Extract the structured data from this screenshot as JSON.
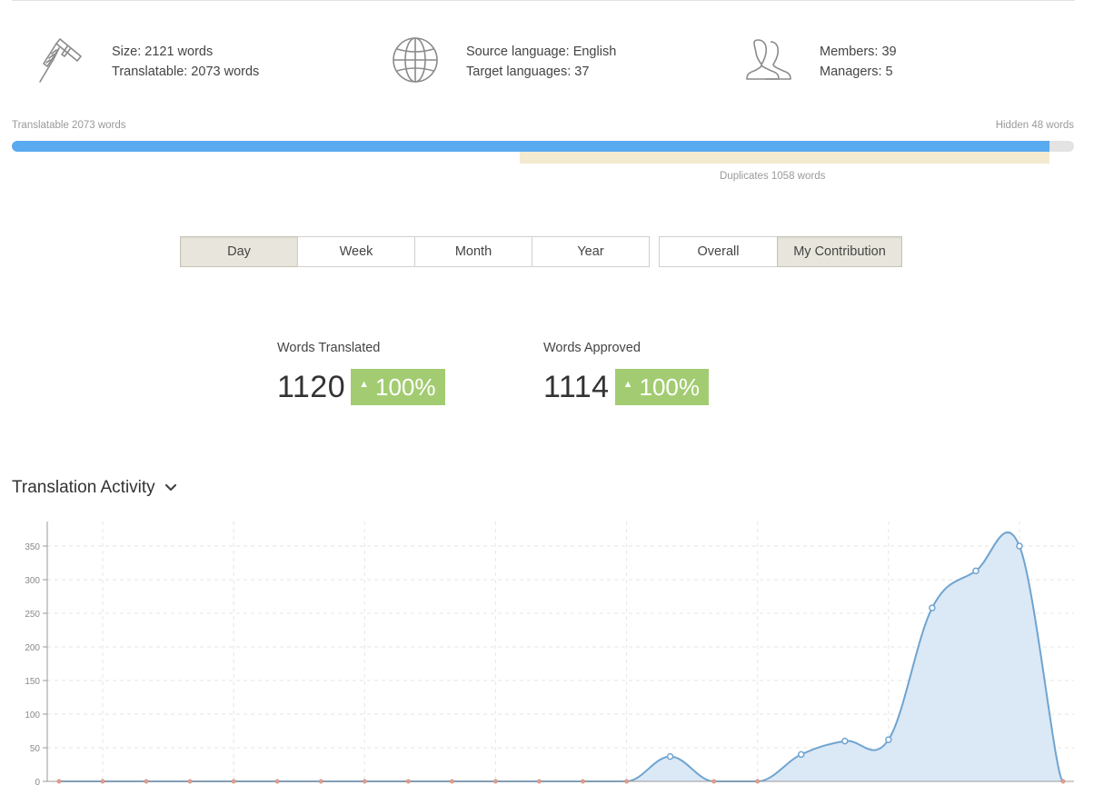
{
  "stats": {
    "size": {
      "size_line": "Size: 2121 words",
      "translatable_line": "Translatable: 2073 words",
      "icon": "calipers-icon"
    },
    "language": {
      "source_line": "Source language: English",
      "target_line": "Target languages: 37",
      "icon": "globe-icon"
    },
    "team": {
      "members_line": "Members: 39",
      "managers_line": "Managers: 5",
      "icon": "users-icon"
    }
  },
  "progress": {
    "translatable_label": "Translatable 2073 words",
    "hidden_label": "Hidden 48 words",
    "duplicates_label": "Duplicates 1058 words",
    "translatable_fraction": 0.977,
    "duplicates_fraction": 0.499,
    "fill_color": "#5aaaf0",
    "duplicates_color": "#f3ead0"
  },
  "period_tabs": {
    "items": [
      {
        "label": "Day",
        "active": true
      },
      {
        "label": "Week",
        "active": false
      },
      {
        "label": "Month",
        "active": false
      },
      {
        "label": "Year",
        "active": false
      }
    ]
  },
  "scope_tabs": {
    "items": [
      {
        "label": "Overall",
        "active": false
      },
      {
        "label": "My Contribution",
        "active": true
      }
    ]
  },
  "metrics": {
    "translated": {
      "label": "Words Translated",
      "value": "1120",
      "change": "100%"
    },
    "approved": {
      "label": "Words Approved",
      "value": "1114",
      "change": "100%"
    },
    "badge_color": "#a3cc72"
  },
  "activity": {
    "title": "Translation Activity"
  },
  "chart_data": {
    "type": "area",
    "title": "",
    "xlabel": "",
    "ylabel": "",
    "ylim": [
      0,
      380
    ],
    "yticks": [
      0,
      50,
      100,
      150,
      200,
      250,
      300,
      350
    ],
    "grid": true,
    "x": [
      0,
      1,
      2,
      3,
      4,
      5,
      6,
      7,
      8,
      9,
      10,
      11,
      12,
      13,
      14,
      15,
      16,
      17,
      18,
      19,
      20,
      21,
      22,
      23
    ],
    "series": [
      {
        "values": [
          0,
          0,
          0,
          0,
          0,
          0,
          0,
          0,
          0,
          0,
          0,
          0,
          0,
          0,
          37,
          0,
          0,
          40,
          60,
          62,
          258,
          313,
          350,
          0
        ]
      }
    ],
    "line_color": "#6fa4d0",
    "fill_color": "#dbe8f6"
  }
}
